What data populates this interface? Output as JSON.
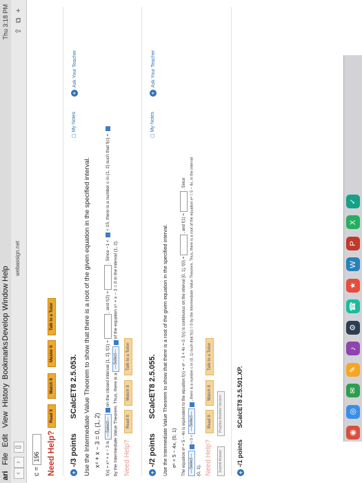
{
  "menubar": {
    "apple": "ari",
    "items": [
      "File",
      "Edit",
      "View",
      "History",
      "Bookmarks",
      "Develop",
      "Window",
      "Help"
    ],
    "status_right": "Thu 3:18 PM"
  },
  "toolbar": {
    "url": "webassign.net"
  },
  "prev_answer": {
    "label": "c =",
    "value": "196"
  },
  "help": {
    "label": "Need Help?",
    "read_it": "Read It",
    "watch_it": "Watch It",
    "master_it": "Master It",
    "talk": "Talk to a Tutor"
  },
  "q1": {
    "points": "-/3 points",
    "code": "SCalcET8 2.5.053.",
    "my_notes": "My Notes",
    "ask_teacher": "Ask Your Teacher",
    "prompt": "Use the Intermediate Value Theorem to show that there is a root of the given equation in the specified interval.",
    "equation": "x⁴ + x − 3 = 0,   (1, 2)",
    "line1a": "f(x) = x⁴ + x − 3 is",
    "select": "---Select---",
    "line1b": "on the closed interval [1, 2], f(1) =",
    "line1c": ", and f(2) =",
    "line1d": ". Since −1 <",
    "line1e": "< 15, there is a number c in (1, 2) such that f(c) =",
    "line2a": "by the Intermediate Value Theorem. Thus, there is a",
    "line2b": "of the equation x⁴ + x − 3 = 0 in the interval (1, 2).",
    "need_help": "Need Help?",
    "read_it": "Read It",
    "watch_it": "Watch It",
    "talk": "Talk to a Tutor"
  },
  "q2": {
    "points": "-/2 points",
    "code": "SCalcET8 2.5.055.",
    "my_notes": "My Notes",
    "ask_teacher": "Ask Your Teacher",
    "prompt": "Use the Intermediate Value Theorem to show that there is a root of the given equation in the specified interval.",
    "equation": "eˣ = 5 − 4x,   (0, 1)",
    "line1": "The equation eˣ = 5 − 4x is equivalent to the equation f(x) = eˣ − 5 + 4x = 0.  f(x) is continuous on the interval [0, 1], f(0) =",
    "line1b": ", and f(1) =",
    "line1c": ". Since",
    "line2a": "< 0 <",
    "line2b": ", there is a number c in (0, 1) such that f(c) = 0 by the Intermediate Value Theorem. Thus, there is a root of the equation eˣ = 5 − 4x, in the interval",
    "line3": "(0, 1).",
    "need_help": "Need Help?",
    "read_it": "Read It",
    "watch_it": "Watch It",
    "talk": "Talk to a Tutor",
    "submit": "Submit Answer",
    "practice": "Practice Another Version"
  },
  "q3": {
    "points": "-/1 points",
    "code": "SCalcET8 2.5.501.XP."
  }
}
